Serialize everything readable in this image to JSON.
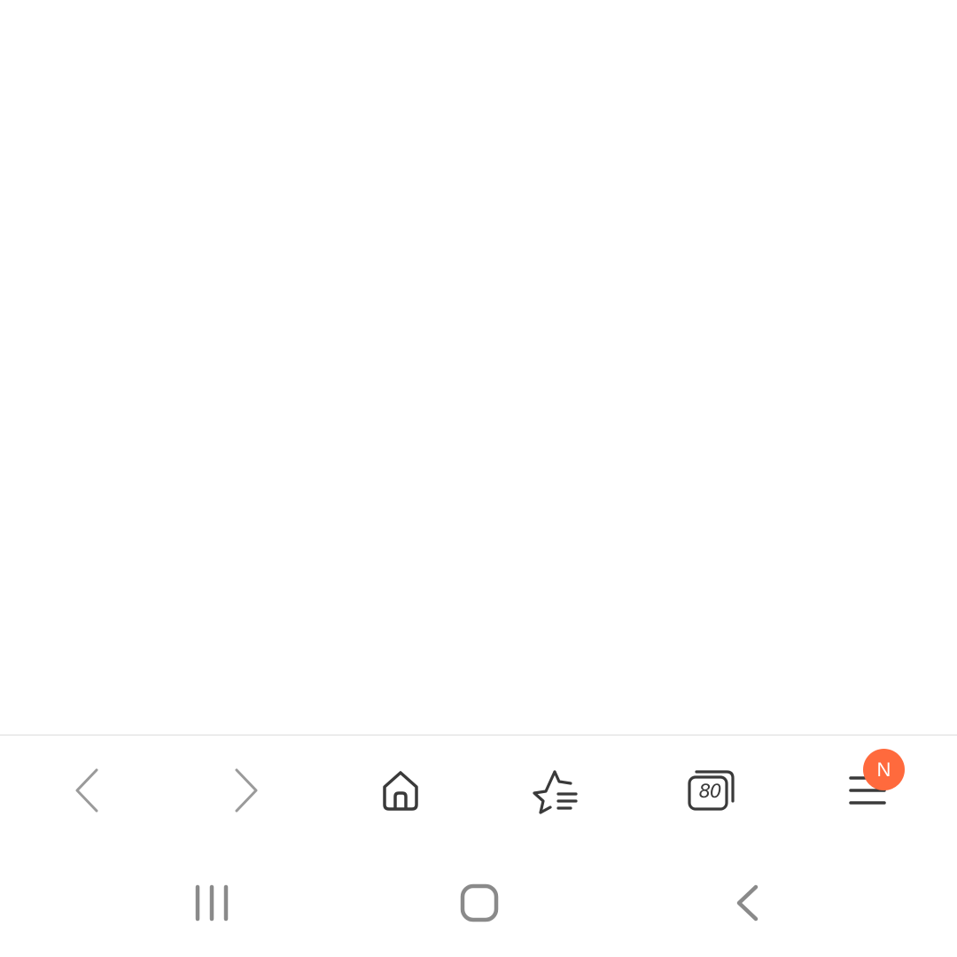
{
  "browser_toolbar": {
    "back": {
      "icon": "chevron-left-icon",
      "enabled": false
    },
    "forward": {
      "icon": "chevron-right-icon",
      "enabled": false
    },
    "home": {
      "icon": "home-icon"
    },
    "bookmarks": {
      "icon": "star-list-icon"
    },
    "tabs": {
      "icon": "tabs-icon",
      "count": "80"
    },
    "menu": {
      "icon": "hamburger-menu-icon",
      "badge": "N",
      "badge_color": "#ff6a3d"
    }
  },
  "system_nav": {
    "recents": {
      "icon": "recent-apps-icon"
    },
    "home": {
      "icon": "home-rounded-square-icon"
    },
    "back": {
      "icon": "back-chevron-icon"
    }
  },
  "colors": {
    "icon_dark": "#3a3a3a",
    "icon_disabled": "#9a9a9a",
    "divider": "#dcdcdc",
    "accent": "#ff6a3d"
  }
}
